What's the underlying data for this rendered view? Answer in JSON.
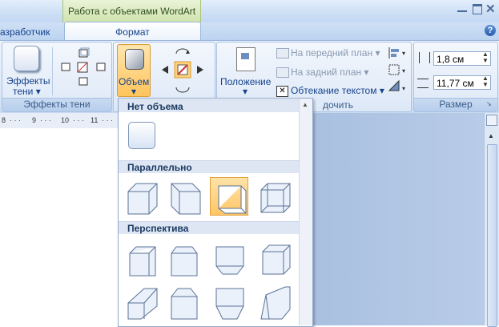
{
  "title_bar": {
    "context_title": "Работа с объектами WordArt"
  },
  "tabs": {
    "developer": "азработчик",
    "format": "Формат"
  },
  "ribbon": {
    "shadow_effects": {
      "button_line1": "Эффекты",
      "button_line2": "тени",
      "group_label": "Эффекты тени"
    },
    "volume": {
      "button_label": "Объем"
    },
    "arrange": {
      "position_label": "Положение",
      "bring_forward": "На передний план",
      "send_backward": "На задний план",
      "text_wrap": "Обтекание текстом",
      "group_label_fragment": "дочить"
    },
    "size": {
      "height_value": "1,8 см",
      "width_value": "11,77 см",
      "group_label": "Размер"
    }
  },
  "ruler": {
    "ticks": [
      "8",
      "9",
      "10",
      "11"
    ]
  },
  "gallery": {
    "sections": [
      {
        "title": "Нет объема",
        "count": 1
      },
      {
        "title": "Параллельно",
        "count": 4,
        "selected_index": 2
      },
      {
        "title": "Перспектива",
        "count": 8
      }
    ]
  },
  "colors": {
    "accent": "#15428b",
    "ribbon_bg": "#dbe7f7",
    "selection": "#ffc666",
    "context_tab": "#cfe3ad"
  }
}
